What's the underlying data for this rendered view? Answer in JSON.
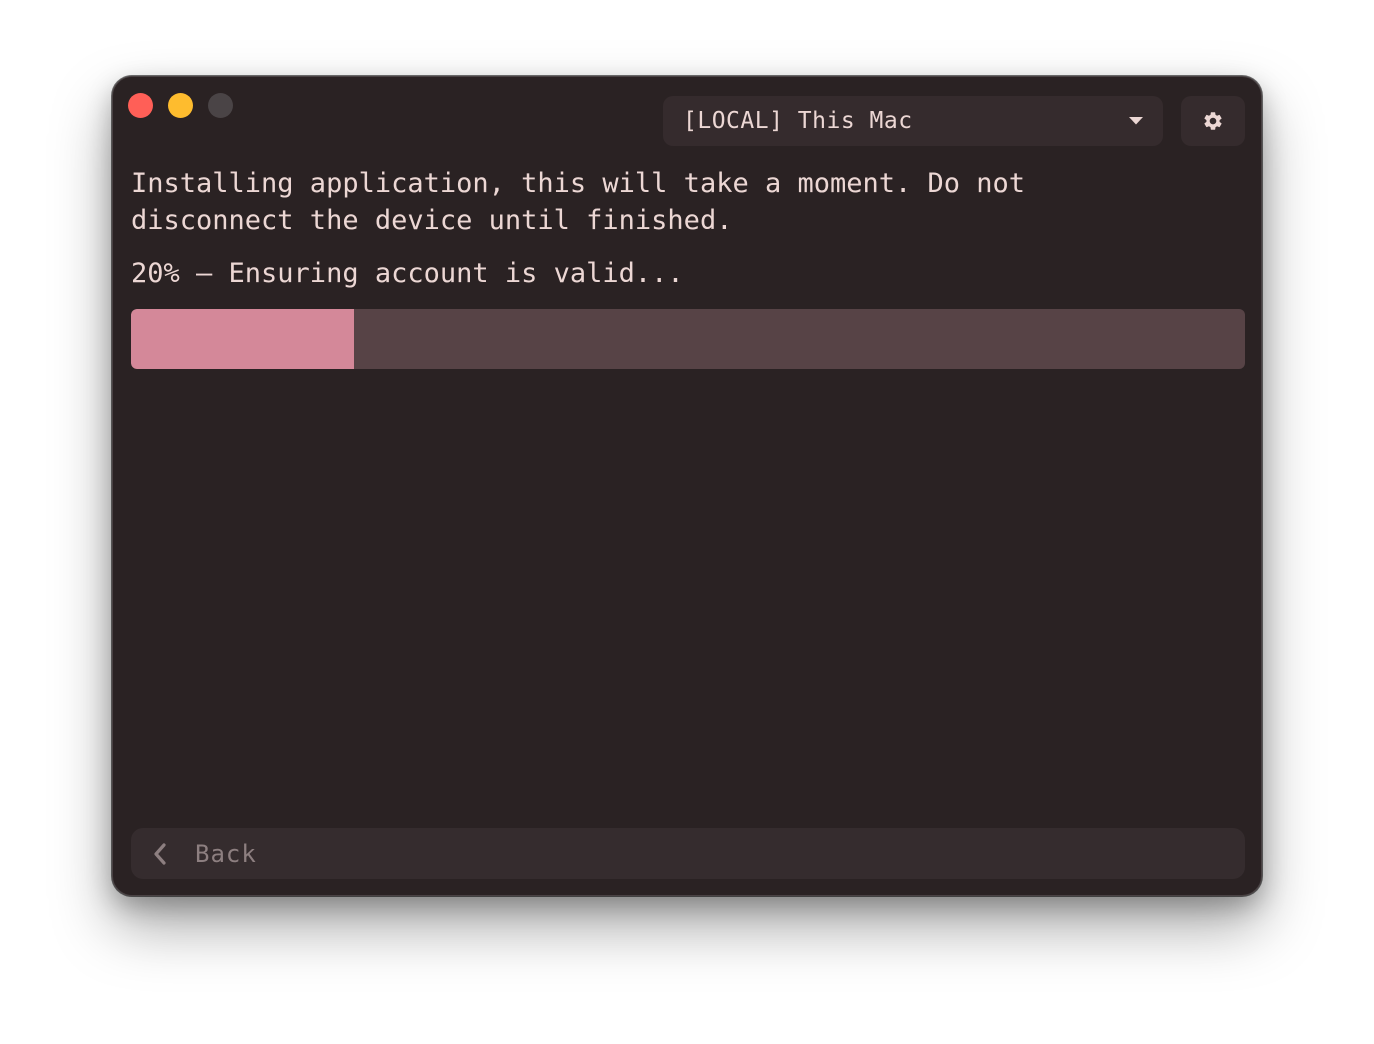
{
  "device_selector": {
    "label": "[LOCAL] This Mac"
  },
  "icons": {
    "dropdown": "chevron-down-icon",
    "settings": "gear-icon",
    "back": "chevron-left-icon"
  },
  "install": {
    "message": "Installing application, this will take a moment. Do not disconnect the device until finished.",
    "status_text": "20% — Ensuring account is valid...",
    "progress_percent": 20
  },
  "footer": {
    "back_label": "Back"
  },
  "colors": {
    "window_bg": "#2a2223",
    "accent": "#d48899",
    "track": "#574346",
    "close": "#ff5f57",
    "minimize": "#febc2e",
    "zoom_disabled": "#4a4446"
  }
}
